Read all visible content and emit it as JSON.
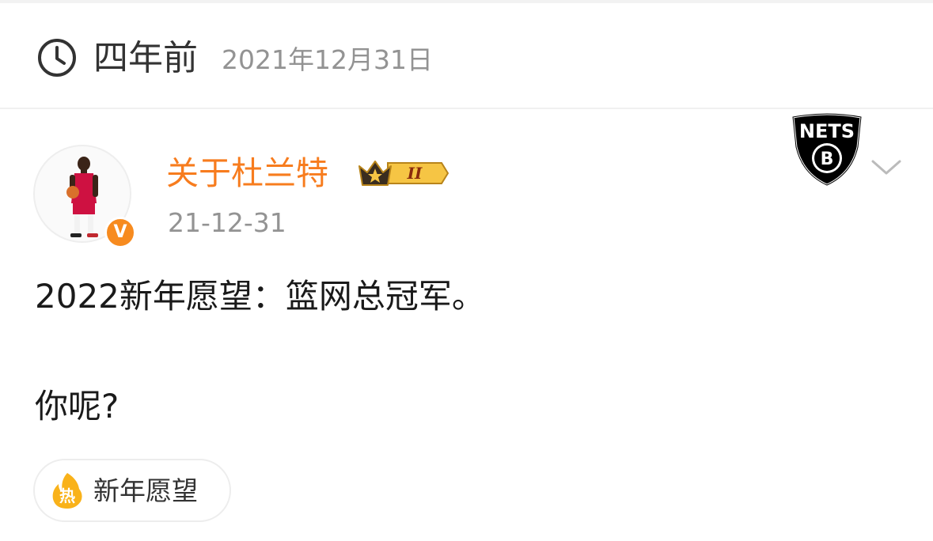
{
  "memory_header": {
    "ago": "四年前",
    "date": "2021年12月31日"
  },
  "author": {
    "name": "关于杜兰特",
    "verified_mark": "V",
    "level_badge": "II",
    "post_time": "21-12-31"
  },
  "team_logo": {
    "text": "NETS",
    "letter": "B"
  },
  "post": {
    "lines": [
      "2022新年愿望：篮网总冠军。",
      "你呢?"
    ]
  },
  "topic": {
    "label": "新年愿望",
    "icon_glyph": "热"
  },
  "colors": {
    "username": "#f77c1e",
    "verified": "#f78b1f",
    "meta_gray": "#939393",
    "text": "#1a1a1a",
    "hot_icon": "#f9b21a"
  },
  "icons": {
    "memory": "clock-icon",
    "menu": "chevron-down-icon",
    "topic": "hot-icon"
  }
}
